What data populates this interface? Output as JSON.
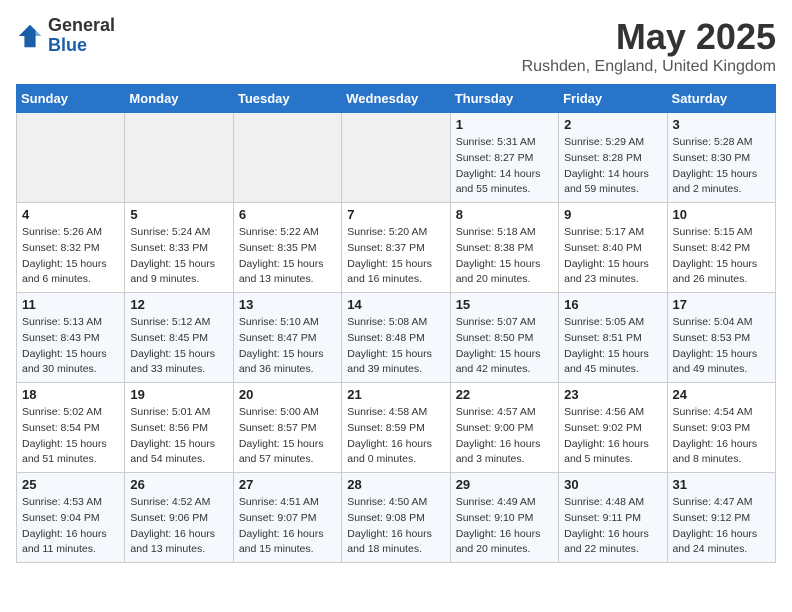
{
  "header": {
    "logo_general": "General",
    "logo_blue": "Blue",
    "month_title": "May 2025",
    "location": "Rushden, England, United Kingdom"
  },
  "weekdays": [
    "Sunday",
    "Monday",
    "Tuesday",
    "Wednesday",
    "Thursday",
    "Friday",
    "Saturday"
  ],
  "weeks": [
    [
      {
        "day": "",
        "info": ""
      },
      {
        "day": "",
        "info": ""
      },
      {
        "day": "",
        "info": ""
      },
      {
        "day": "",
        "info": ""
      },
      {
        "day": "1",
        "info": "Sunrise: 5:31 AM\nSunset: 8:27 PM\nDaylight: 14 hours\nand 55 minutes."
      },
      {
        "day": "2",
        "info": "Sunrise: 5:29 AM\nSunset: 8:28 PM\nDaylight: 14 hours\nand 59 minutes."
      },
      {
        "day": "3",
        "info": "Sunrise: 5:28 AM\nSunset: 8:30 PM\nDaylight: 15 hours\nand 2 minutes."
      }
    ],
    [
      {
        "day": "4",
        "info": "Sunrise: 5:26 AM\nSunset: 8:32 PM\nDaylight: 15 hours\nand 6 minutes."
      },
      {
        "day": "5",
        "info": "Sunrise: 5:24 AM\nSunset: 8:33 PM\nDaylight: 15 hours\nand 9 minutes."
      },
      {
        "day": "6",
        "info": "Sunrise: 5:22 AM\nSunset: 8:35 PM\nDaylight: 15 hours\nand 13 minutes."
      },
      {
        "day": "7",
        "info": "Sunrise: 5:20 AM\nSunset: 8:37 PM\nDaylight: 15 hours\nand 16 minutes."
      },
      {
        "day": "8",
        "info": "Sunrise: 5:18 AM\nSunset: 8:38 PM\nDaylight: 15 hours\nand 20 minutes."
      },
      {
        "day": "9",
        "info": "Sunrise: 5:17 AM\nSunset: 8:40 PM\nDaylight: 15 hours\nand 23 minutes."
      },
      {
        "day": "10",
        "info": "Sunrise: 5:15 AM\nSunset: 8:42 PM\nDaylight: 15 hours\nand 26 minutes."
      }
    ],
    [
      {
        "day": "11",
        "info": "Sunrise: 5:13 AM\nSunset: 8:43 PM\nDaylight: 15 hours\nand 30 minutes."
      },
      {
        "day": "12",
        "info": "Sunrise: 5:12 AM\nSunset: 8:45 PM\nDaylight: 15 hours\nand 33 minutes."
      },
      {
        "day": "13",
        "info": "Sunrise: 5:10 AM\nSunset: 8:47 PM\nDaylight: 15 hours\nand 36 minutes."
      },
      {
        "day": "14",
        "info": "Sunrise: 5:08 AM\nSunset: 8:48 PM\nDaylight: 15 hours\nand 39 minutes."
      },
      {
        "day": "15",
        "info": "Sunrise: 5:07 AM\nSunset: 8:50 PM\nDaylight: 15 hours\nand 42 minutes."
      },
      {
        "day": "16",
        "info": "Sunrise: 5:05 AM\nSunset: 8:51 PM\nDaylight: 15 hours\nand 45 minutes."
      },
      {
        "day": "17",
        "info": "Sunrise: 5:04 AM\nSunset: 8:53 PM\nDaylight: 15 hours\nand 49 minutes."
      }
    ],
    [
      {
        "day": "18",
        "info": "Sunrise: 5:02 AM\nSunset: 8:54 PM\nDaylight: 15 hours\nand 51 minutes."
      },
      {
        "day": "19",
        "info": "Sunrise: 5:01 AM\nSunset: 8:56 PM\nDaylight: 15 hours\nand 54 minutes."
      },
      {
        "day": "20",
        "info": "Sunrise: 5:00 AM\nSunset: 8:57 PM\nDaylight: 15 hours\nand 57 minutes."
      },
      {
        "day": "21",
        "info": "Sunrise: 4:58 AM\nSunset: 8:59 PM\nDaylight: 16 hours\nand 0 minutes."
      },
      {
        "day": "22",
        "info": "Sunrise: 4:57 AM\nSunset: 9:00 PM\nDaylight: 16 hours\nand 3 minutes."
      },
      {
        "day": "23",
        "info": "Sunrise: 4:56 AM\nSunset: 9:02 PM\nDaylight: 16 hours\nand 5 minutes."
      },
      {
        "day": "24",
        "info": "Sunrise: 4:54 AM\nSunset: 9:03 PM\nDaylight: 16 hours\nand 8 minutes."
      }
    ],
    [
      {
        "day": "25",
        "info": "Sunrise: 4:53 AM\nSunset: 9:04 PM\nDaylight: 16 hours\nand 11 minutes."
      },
      {
        "day": "26",
        "info": "Sunrise: 4:52 AM\nSunset: 9:06 PM\nDaylight: 16 hours\nand 13 minutes."
      },
      {
        "day": "27",
        "info": "Sunrise: 4:51 AM\nSunset: 9:07 PM\nDaylight: 16 hours\nand 15 minutes."
      },
      {
        "day": "28",
        "info": "Sunrise: 4:50 AM\nSunset: 9:08 PM\nDaylight: 16 hours\nand 18 minutes."
      },
      {
        "day": "29",
        "info": "Sunrise: 4:49 AM\nSunset: 9:10 PM\nDaylight: 16 hours\nand 20 minutes."
      },
      {
        "day": "30",
        "info": "Sunrise: 4:48 AM\nSunset: 9:11 PM\nDaylight: 16 hours\nand 22 minutes."
      },
      {
        "day": "31",
        "info": "Sunrise: 4:47 AM\nSunset: 9:12 PM\nDaylight: 16 hours\nand 24 minutes."
      }
    ]
  ]
}
